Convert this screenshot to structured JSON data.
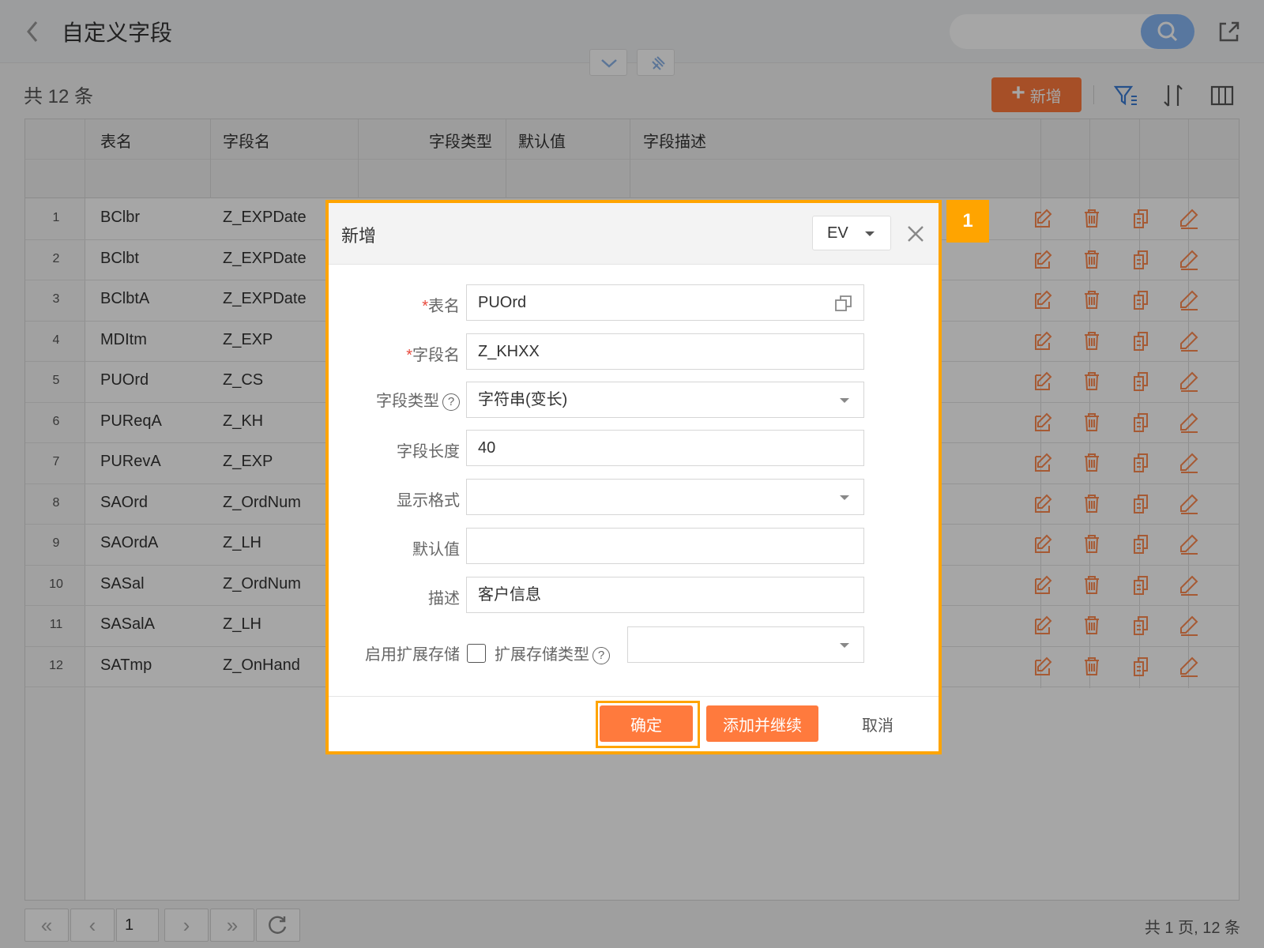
{
  "header": {
    "title": "自定义字段"
  },
  "toolbar": {
    "count_text": "共 12 条",
    "add_label": "新增"
  },
  "table": {
    "columns": [
      "表名",
      "字段名",
      "字段类型",
      "默认值",
      "字段描述"
    ],
    "rows": [
      {
        "num": "1",
        "table": "BClbr",
        "field": "Z_EXPDate"
      },
      {
        "num": "2",
        "table": "BClbt",
        "field": "Z_EXPDate"
      },
      {
        "num": "3",
        "table": "BClbtA",
        "field": "Z_EXPDate"
      },
      {
        "num": "4",
        "table": "MDItm",
        "field": "Z_EXP"
      },
      {
        "num": "5",
        "table": "PUOrd",
        "field": "Z_CS"
      },
      {
        "num": "6",
        "table": "PUReqA",
        "field": "Z_KH"
      },
      {
        "num": "7",
        "table": "PURevA",
        "field": "Z_EXP"
      },
      {
        "num": "8",
        "table": "SAOrd",
        "field": "Z_OrdNum"
      },
      {
        "num": "9",
        "table": "SAOrdA",
        "field": "Z_LH"
      },
      {
        "num": "10",
        "table": "SASal",
        "field": "Z_OrdNum"
      },
      {
        "num": "11",
        "table": "SASalA",
        "field": "Z_LH"
      },
      {
        "num": "12",
        "table": "SATmp",
        "field": "Z_OnHand"
      }
    ]
  },
  "pager": {
    "page": "1",
    "total_text": "共 1 页, 12 条"
  },
  "dialog": {
    "title": "新增",
    "lang": "EV",
    "fields": {
      "table_label": "表名",
      "table_value": "PUOrd",
      "field_label": "字段名",
      "field_value": "Z_KHXX",
      "type_label": "字段类型",
      "type_value": "字符串(变长)",
      "length_label": "字段长度",
      "length_value": "40",
      "format_label": "显示格式",
      "format_value": "",
      "default_label": "默认值",
      "default_value": "",
      "desc_label": "描述",
      "desc_value": "客户信息",
      "ext_label": "启用扩展存储",
      "ext_type_label": "扩展存储类型",
      "ext_type_value": ""
    },
    "buttons": {
      "ok": "确定",
      "add_continue": "添加并继续",
      "cancel": "取消"
    }
  },
  "step_marker": "1",
  "colors": {
    "accent": "#ff7a3d",
    "highlight": "#ffa400",
    "search": "#87b7f5"
  }
}
